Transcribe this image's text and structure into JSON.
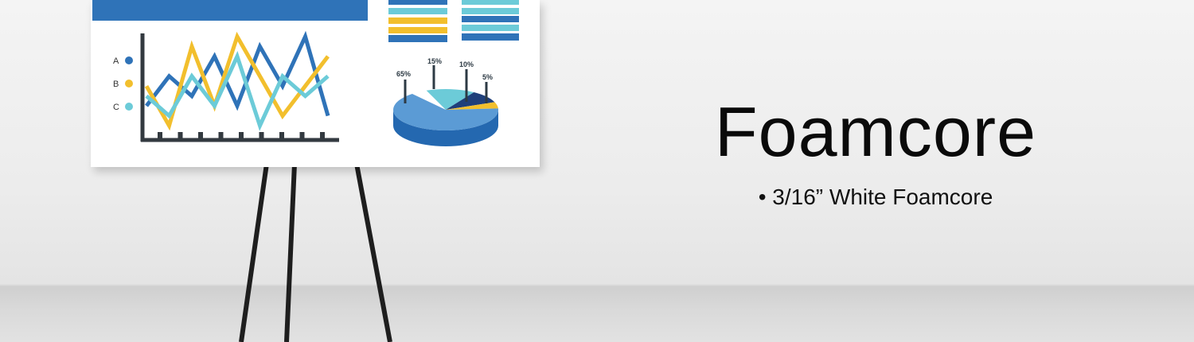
{
  "heading": {
    "title": "Foamcore",
    "bullet": "• 3/16” White Foamcore"
  },
  "board_chart": {
    "legend": [
      "A",
      "B",
      "C"
    ],
    "pie_labels": [
      "65%",
      "15%",
      "10%",
      "5%"
    ]
  },
  "chart_data": [
    {
      "type": "line",
      "series": [
        {
          "name": "A",
          "values": [
            3,
            6,
            4,
            8,
            3,
            9,
            5,
            10,
            2
          ]
        },
        {
          "name": "B",
          "values": [
            5,
            1,
            9,
            3,
            10,
            6,
            2,
            5,
            8
          ]
        },
        {
          "name": "C",
          "values": [
            4,
            2,
            6,
            3,
            8,
            1,
            6,
            4,
            6
          ]
        }
      ]
    },
    {
      "type": "pie",
      "labels": [
        "65%",
        "15%",
        "10%",
        "5%"
      ],
      "values": [
        65,
        15,
        10,
        5
      ]
    }
  ],
  "colors": {
    "blue": "#2f73b8",
    "yellow": "#f2bf2d",
    "teal": "#6ccbd8",
    "navy": "#1f3f7a",
    "axis": "#333a40"
  }
}
